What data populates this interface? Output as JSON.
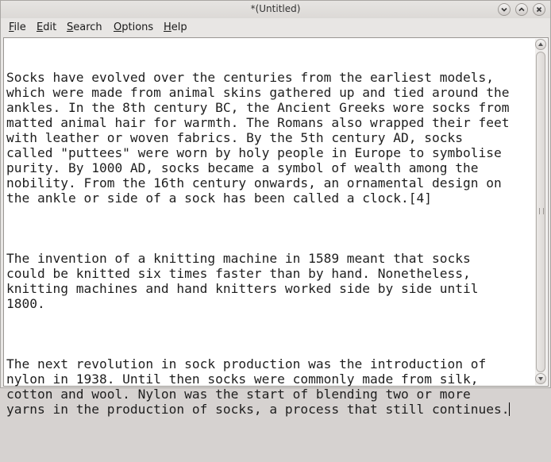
{
  "window": {
    "title": "*(Untitled)"
  },
  "menubar": {
    "items": [
      {
        "acc": "F",
        "rest": "ile"
      },
      {
        "acc": "E",
        "rest": "dit"
      },
      {
        "acc": "S",
        "rest": "earch"
      },
      {
        "acc": "O",
        "rest": "ptions"
      },
      {
        "acc": "H",
        "rest": "elp"
      }
    ]
  },
  "editor": {
    "paragraphs": [
      "Socks have evolved over the centuries from the earliest models,\nwhich were made from animal skins gathered up and tied around the\nankles. In the 8th century BC, the Ancient Greeks wore socks from\nmatted animal hair for warmth. The Romans also wrapped their feet\nwith leather or woven fabrics. By the 5th century AD, socks\ncalled \"puttees\" were worn by holy people in Europe to symbolise\npurity. By 1000 AD, socks became a symbol of wealth among the\nnobility. From the 16th century onwards, an ornamental design on\nthe ankle or side of a sock has been called a clock.[4]",
      "The invention of a knitting machine in 1589 meant that socks\ncould be knitted six times faster than by hand. Nonetheless,\nknitting machines and hand knitters worked side by side until\n1800.",
      "The next revolution in sock production was the introduction of\nnylon in 1938. Until then socks were commonly made from silk,\ncotton and wool. Nylon was the start of blending two or more\nyarns in the production of socks, a process that still continues."
    ]
  },
  "icons": {
    "minimize": "chevron-down-icon",
    "maximize": "chevron-up-icon",
    "close": "close-icon",
    "scroll_up": "arrow-up-icon",
    "scroll_down": "arrow-down-icon"
  }
}
